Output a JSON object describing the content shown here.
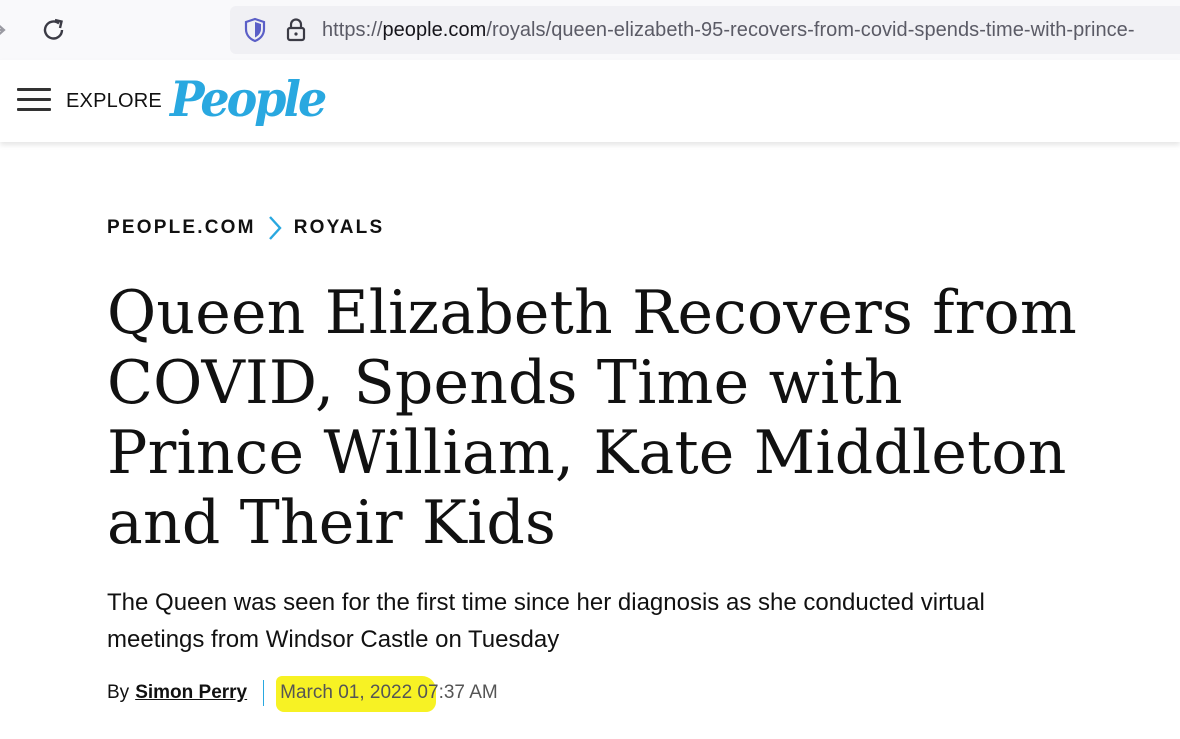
{
  "browser": {
    "url_prefix": "https://",
    "url_host": "people.com",
    "url_path": "/royals/queen-elizabeth-95-recovers-from-covid-spends-time-with-prince-"
  },
  "header": {
    "explore_label": "EXPLORE",
    "logo_text": "People",
    "brand_color": "#29a8e0"
  },
  "breadcrumb": {
    "items": [
      "PEOPLE.COM",
      "ROYALS"
    ]
  },
  "article": {
    "headline": "Queen Elizabeth Recovers from COVID, Spends Time with Prince William, Kate Middleton and Their Kids",
    "dek": "The Queen was seen for the first time since her diagnosis as she conducted virtual meetings from Windsor Castle on Tuesday",
    "byline_prefix": "By",
    "author": "Simon Perry",
    "date": "March 01, 2022 07:37 AM",
    "highlight_color": "#f7f224"
  }
}
